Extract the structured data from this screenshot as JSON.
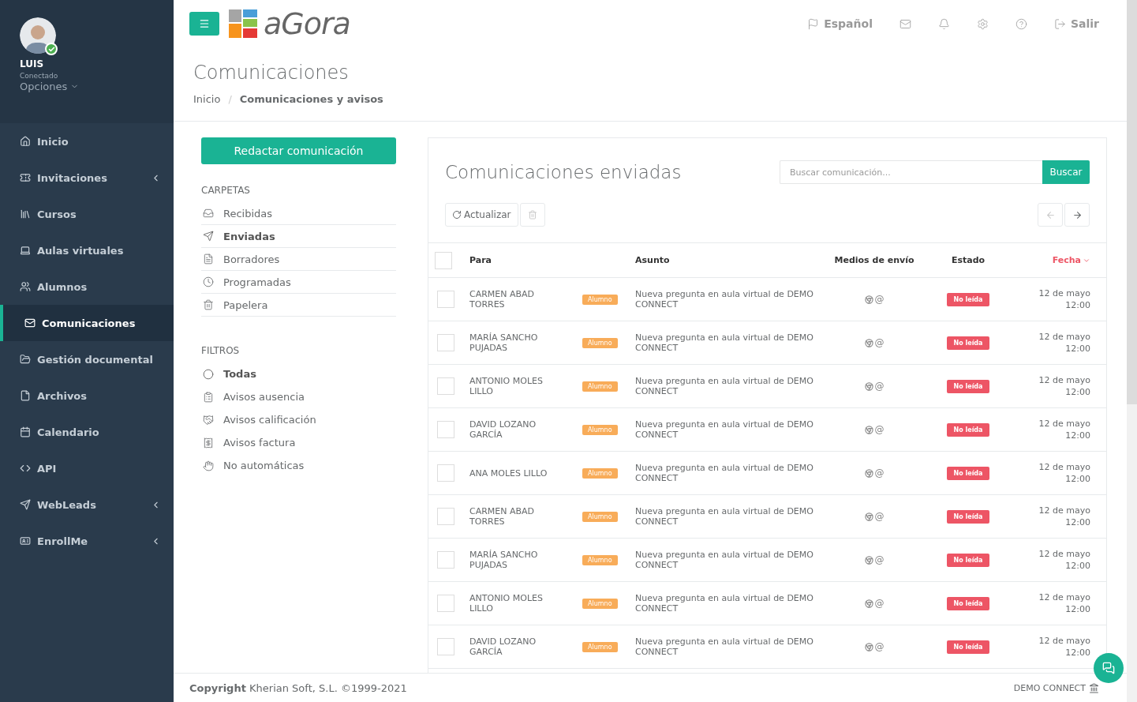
{
  "sidebar": {
    "user": {
      "name": "LUIS",
      "status": "Conectado",
      "online": true,
      "options": "Opciones"
    },
    "items": [
      {
        "label": "Inicio",
        "selected": false,
        "expandable": false
      },
      {
        "label": "Invitaciones",
        "selected": false,
        "expandable": true
      },
      {
        "label": "Cursos",
        "selected": false,
        "expandable": false
      },
      {
        "label": "Aulas virtuales",
        "selected": false,
        "expandable": false
      },
      {
        "label": "Alumnos",
        "selected": false,
        "expandable": false
      },
      {
        "label": "Comunicaciones",
        "selected": true,
        "expandable": false
      },
      {
        "label": "Gestión documental",
        "selected": false,
        "expandable": false
      },
      {
        "label": "Archivos",
        "selected": false,
        "expandable": false
      },
      {
        "label": "Calendario",
        "selected": false,
        "expandable": false
      },
      {
        "label": "API",
        "selected": false,
        "expandable": false
      },
      {
        "label": "WebLeads",
        "selected": false,
        "expandable": true
      },
      {
        "label": "EnrollMe",
        "selected": false,
        "expandable": true
      }
    ]
  },
  "topbar": {
    "logo": "aGora",
    "language": "Español",
    "logout": "Salir"
  },
  "page": {
    "title": "Comunicaciones",
    "breadcrumb_separator": "/",
    "breadcrumb": [
      {
        "label": "Inicio",
        "current": false
      },
      {
        "label": "Comunicaciones y avisos",
        "current": true
      }
    ]
  },
  "folders": {
    "compose": "Redactar comunicación",
    "heading": "CARPETAS",
    "items": [
      {
        "label": "Recibidas",
        "selected": false
      },
      {
        "label": "Enviadas",
        "selected": true
      },
      {
        "label": "Borradores",
        "selected": false
      },
      {
        "label": "Programadas",
        "selected": false
      },
      {
        "label": "Papelera",
        "selected": false
      }
    ]
  },
  "filters": {
    "heading": "FILTROS",
    "items": [
      {
        "label": "Todas",
        "selected": true
      },
      {
        "label": "Avisos ausencia",
        "selected": false
      },
      {
        "label": "Avisos calificación",
        "selected": false
      },
      {
        "label": "Avisos factura",
        "selected": false
      },
      {
        "label": "No automáticas",
        "selected": false
      }
    ]
  },
  "messages": {
    "title": "Comunicaciones enviadas",
    "search": {
      "placeholder": "Buscar comunicación...",
      "button": "Buscar"
    },
    "refresh": "Actualizar",
    "select_all": {
      "checked": false
    },
    "columns": [
      {
        "label": "Para",
        "sorted": false
      },
      {
        "label": "Asunto",
        "sorted": false
      },
      {
        "label": "Medios de envío",
        "sorted": false
      },
      {
        "label": "Estado",
        "sorted": false
      },
      {
        "label": "Fecha",
        "sorted": true
      }
    ],
    "rows": [
      {
        "checked": false,
        "to": "CARMEN ABAD TORRES",
        "tag": "Alumno",
        "subject": "Nueva pregunta en aula virtual de DEMO CONNECT",
        "channel": "@",
        "status": "No leída",
        "date": "12 de mayo",
        "time": "12:00"
      },
      {
        "checked": false,
        "to": "MARÍA SANCHO PUJADAS",
        "tag": "Alumno",
        "subject": "Nueva pregunta en aula virtual de DEMO CONNECT",
        "channel": "@",
        "status": "No leída",
        "date": "12 de mayo",
        "time": "12:00"
      },
      {
        "checked": false,
        "to": "ANTONIO MOLES LILLO",
        "tag": "Alumno",
        "subject": "Nueva pregunta en aula virtual de DEMO CONNECT",
        "channel": "@",
        "status": "No leída",
        "date": "12 de mayo",
        "time": "12:00"
      },
      {
        "checked": false,
        "to": "DAVID LOZANO GARCÍA",
        "tag": "Alumno",
        "subject": "Nueva pregunta en aula virtual de DEMO CONNECT",
        "channel": "@",
        "status": "No leída",
        "date": "12 de mayo",
        "time": "12:00"
      },
      {
        "checked": false,
        "to": "ANA MOLES LILLO",
        "tag": "Alumno",
        "subject": "Nueva pregunta en aula virtual de DEMO CONNECT",
        "channel": "@",
        "status": "No leída",
        "date": "12 de mayo",
        "time": "12:00"
      },
      {
        "checked": false,
        "to": "CARMEN ABAD TORRES",
        "tag": "Alumno",
        "subject": "Nueva pregunta en aula virtual de DEMO CONNECT",
        "channel": "@",
        "status": "No leída",
        "date": "12 de mayo",
        "time": "12:00"
      },
      {
        "checked": false,
        "to": "MARÍA SANCHO PUJADAS",
        "tag": "Alumno",
        "subject": "Nueva pregunta en aula virtual de DEMO CONNECT",
        "channel": "@",
        "status": "No leída",
        "date": "12 de mayo",
        "time": "12:00"
      },
      {
        "checked": false,
        "to": "ANTONIO MOLES LILLO",
        "tag": "Alumno",
        "subject": "Nueva pregunta en aula virtual de DEMO CONNECT",
        "channel": "@",
        "status": "No leída",
        "date": "12 de mayo",
        "time": "12:00"
      },
      {
        "checked": false,
        "to": "DAVID LOZANO GARCÍA",
        "tag": "Alumno",
        "subject": "Nueva pregunta en aula virtual de DEMO CONNECT",
        "channel": "@",
        "status": "No leída",
        "date": "12 de mayo",
        "time": "12:00"
      }
    ]
  },
  "footer": {
    "copyright": "**Copyright** Kherian Soft, S.L. ©1999-2021",
    "company": "DEMO CONNECT"
  }
}
